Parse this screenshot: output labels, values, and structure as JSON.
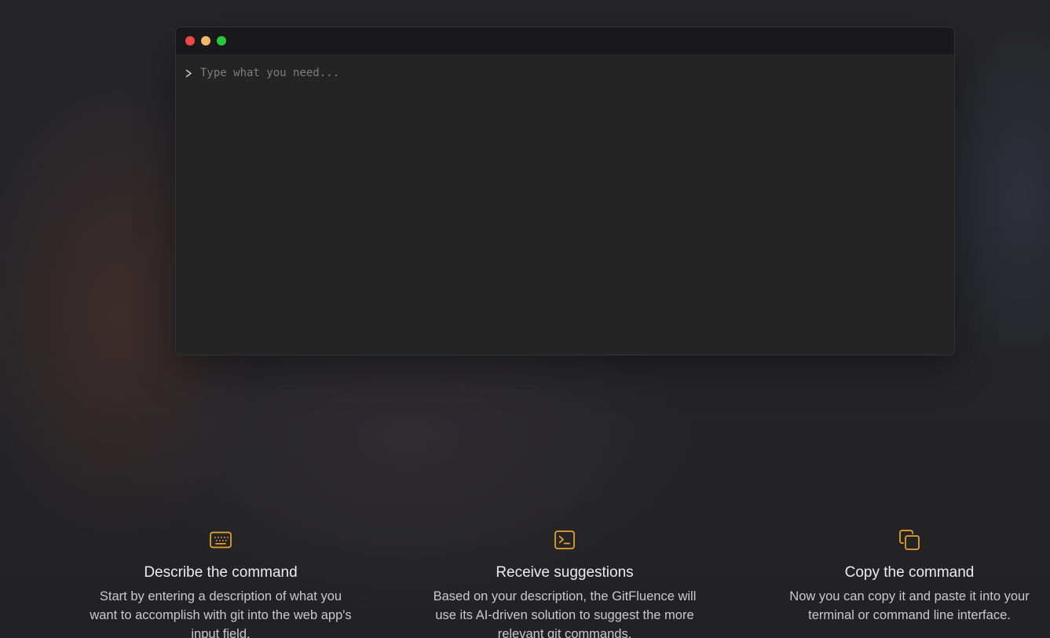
{
  "terminal": {
    "prompt_symbol": ">",
    "input_placeholder": "Type what you need...",
    "input_value": "",
    "window_dots": [
      {
        "name": "close",
        "color": "#ec4845"
      },
      {
        "name": "minimize",
        "color": "#f3b76b"
      },
      {
        "name": "maximize",
        "color": "#27c93f"
      }
    ]
  },
  "accent_color": "#e8a530",
  "features": [
    {
      "icon": "keyboard-icon",
      "title": "Describe the command",
      "description": "Start by entering a description of what you want to accomplish with git into the web app's input field."
    },
    {
      "icon": "terminal-icon",
      "title": "Receive suggestions",
      "description": "Based on your description, the GitFluence will use its AI-driven solution to suggest the more relevant git commands."
    },
    {
      "icon": "copy-icon",
      "title": "Copy the command",
      "description": "Now you can copy it and paste it into your terminal or command line interface."
    }
  ]
}
